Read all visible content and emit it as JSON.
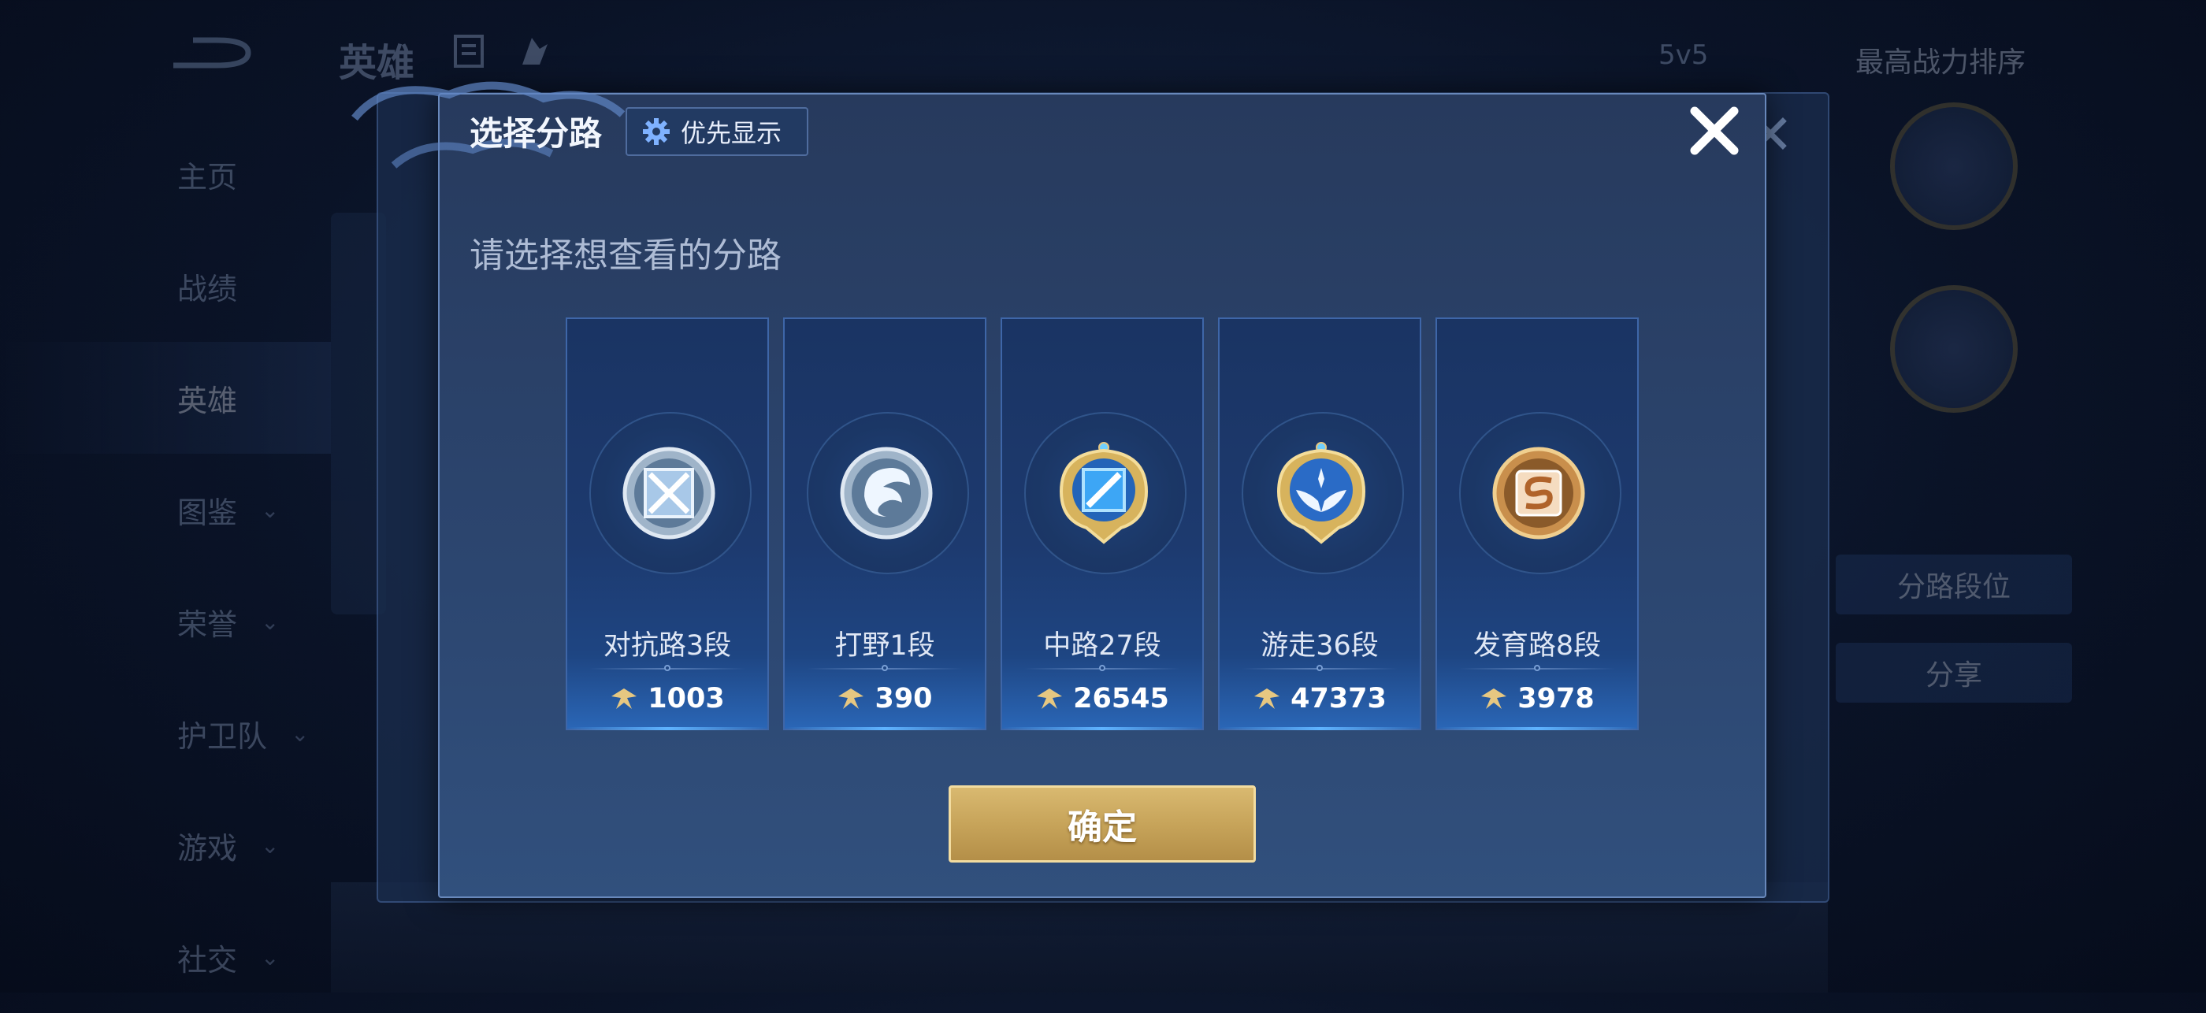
{
  "background_app": {
    "title": "英雄",
    "subtitle": "",
    "mode": "5v5",
    "sort": "最高战力排序",
    "nav_items": [
      {
        "label": "主页",
        "has_chevron": false
      },
      {
        "label": "战绩",
        "has_chevron": false
      },
      {
        "label": "英雄",
        "has_chevron": false,
        "active": true
      },
      {
        "label": "图鉴",
        "has_chevron": true
      },
      {
        "label": "荣誉",
        "has_chevron": true
      },
      {
        "label": "护卫队",
        "has_chevron": true
      },
      {
        "label": "游戏",
        "has_chevron": true
      },
      {
        "label": "社交",
        "has_chevron": true
      }
    ],
    "right_buttons": [
      "分路段位",
      "分享"
    ]
  },
  "dialog": {
    "title": "选择分路",
    "priority_button": {
      "label": "优先显示",
      "icon": "gear-icon"
    },
    "close_icon": "close-icon",
    "subtitle": "请选择想查看的分路",
    "confirm_label": "确定",
    "lanes": [
      {
        "name": "对抗路3段",
        "score": "1003",
        "emblem": "clash-lane-emblem",
        "tier": "silver"
      },
      {
        "name": "打野1段",
        "score": "390",
        "emblem": "jungle-emblem",
        "tier": "silver"
      },
      {
        "name": "中路27段",
        "score": "26545",
        "emblem": "mid-lane-emblem",
        "tier": "gold"
      },
      {
        "name": "游走36段",
        "score": "47373",
        "emblem": "roam-emblem",
        "tier": "gold"
      },
      {
        "name": "发育路8段",
        "score": "3978",
        "emblem": "farm-lane-emblem",
        "tier": "bronze"
      }
    ]
  },
  "colors": {
    "gold": "#d9b970",
    "card_border": "#3e66a8",
    "modal_bg": "#2c4670"
  }
}
